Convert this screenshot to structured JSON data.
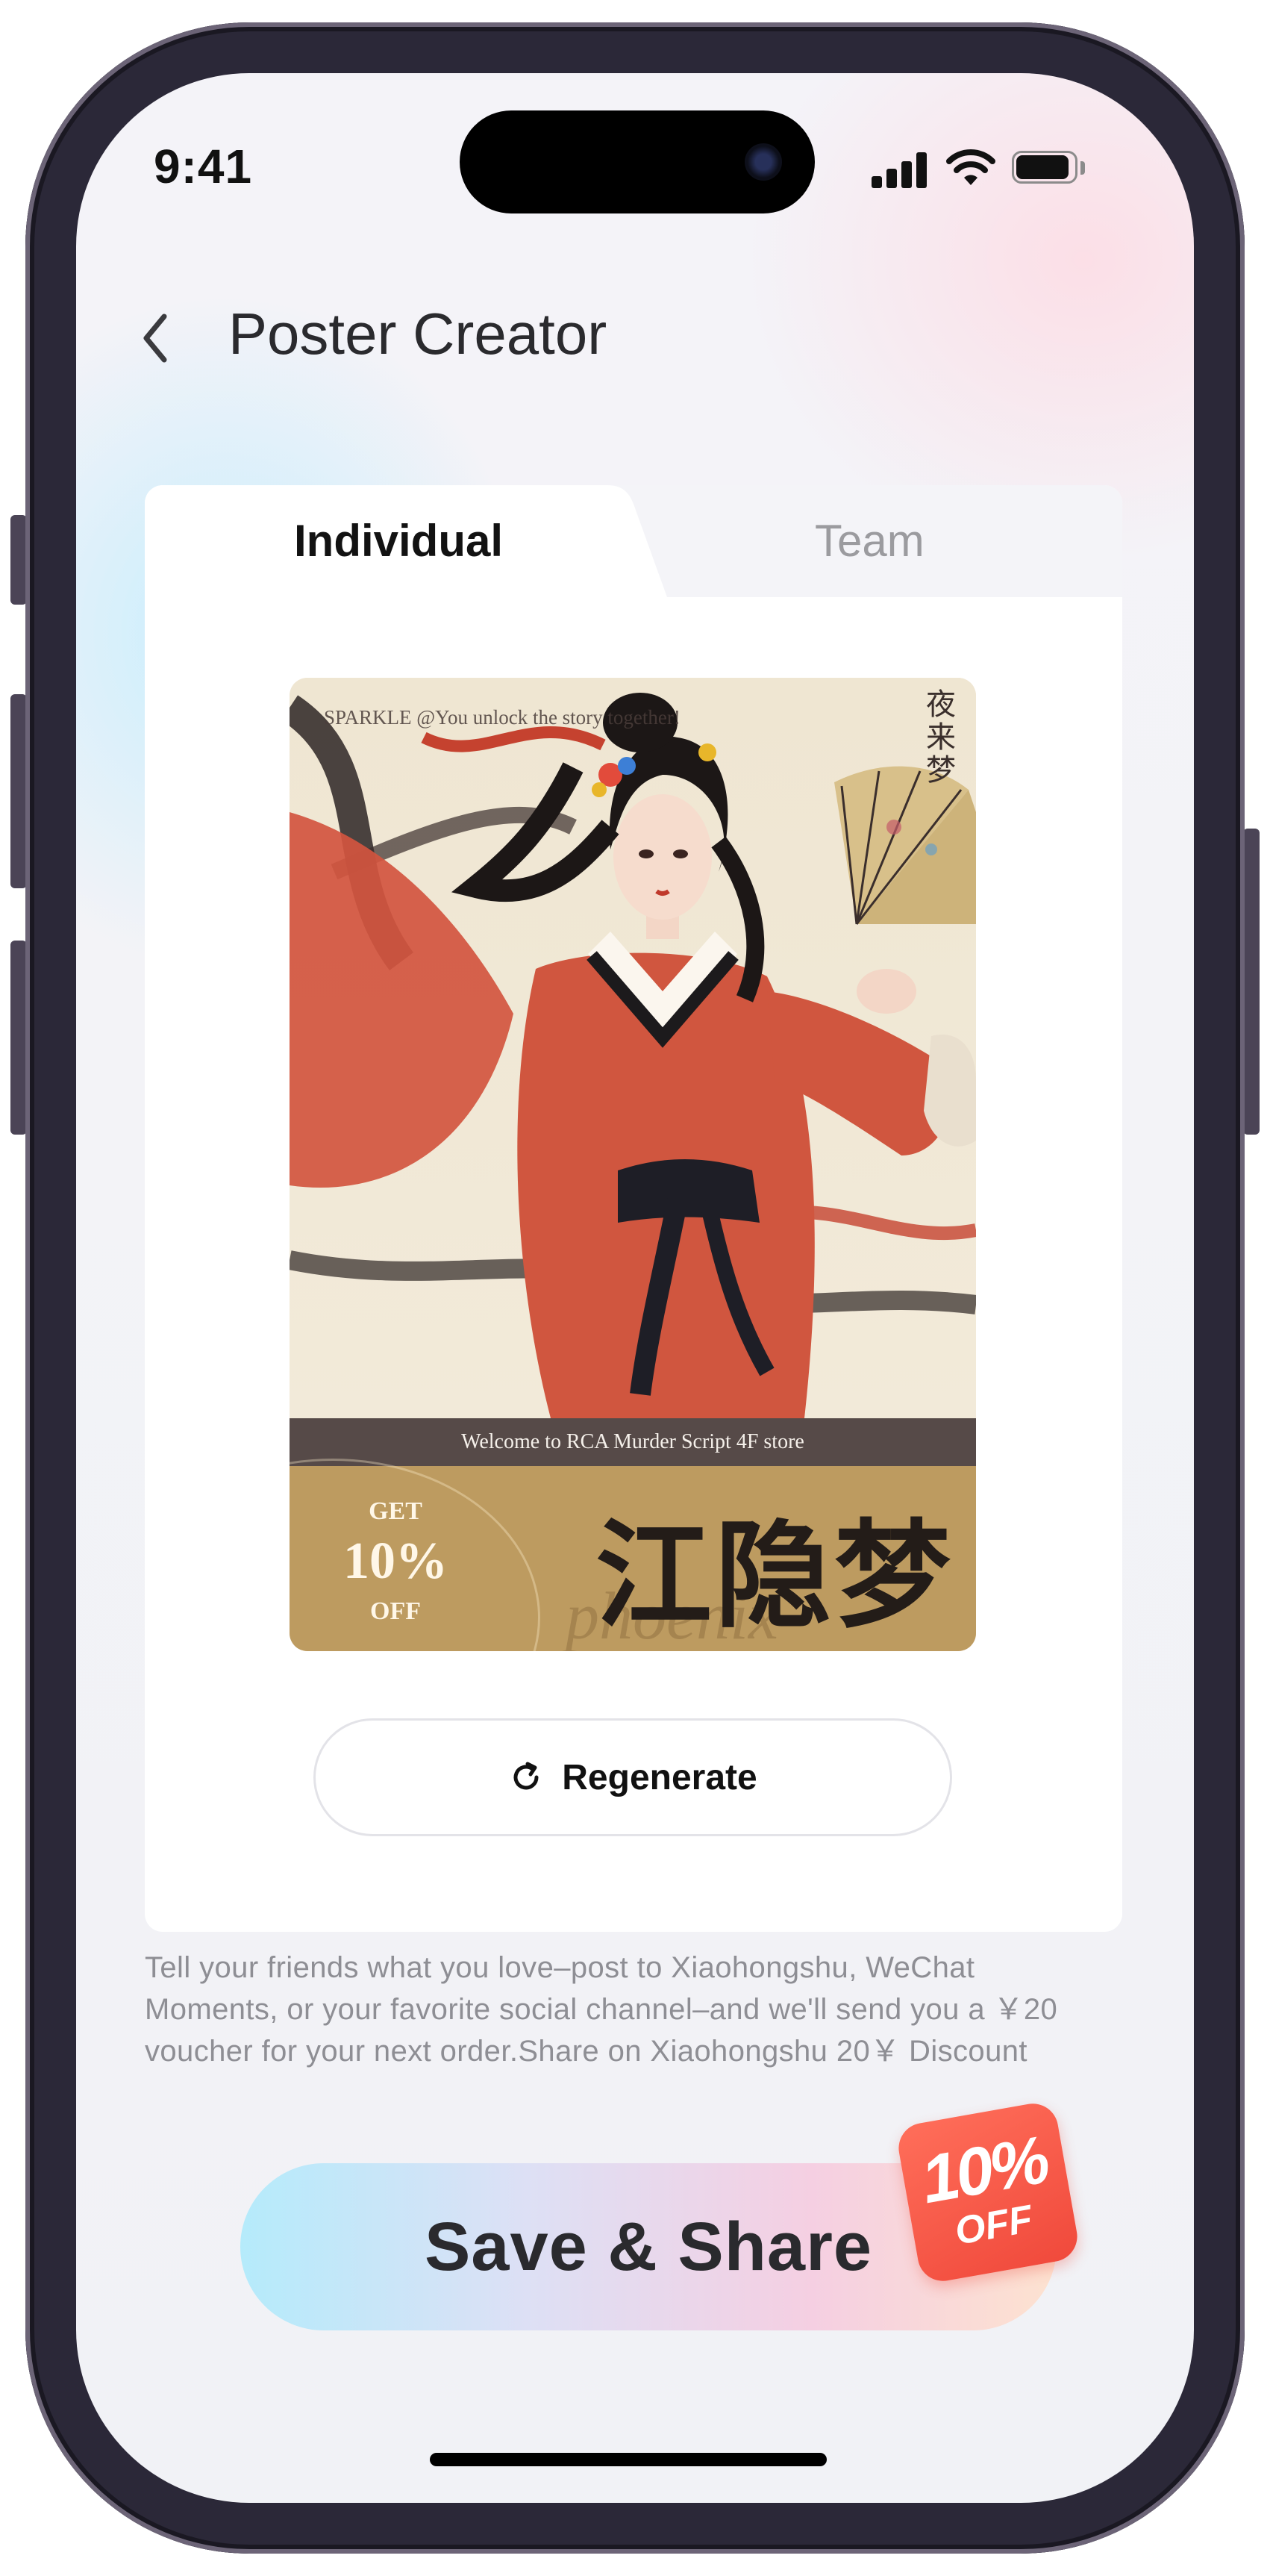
{
  "status_bar": {
    "time": "9:41"
  },
  "header": {
    "title": "Poster Creator"
  },
  "tabs": [
    {
      "label": "Individual",
      "active": true
    },
    {
      "label": "Team",
      "active": false
    }
  ],
  "poster": {
    "watermark": "SPARKLE @You unlock the story together!",
    "seal_text": "夜来梦",
    "welcome": "Welcome to RCA Murder Script 4F store",
    "promo_get": "GET",
    "promo_percent": "10%",
    "promo_off": "OFF",
    "calligraphy": "江隐梦",
    "script_text": "phoenix"
  },
  "regenerate": {
    "label": "Regenerate",
    "icon": "refresh-icon"
  },
  "description": "Tell your friends what you love–post to Xiaohongshu, WeChat Moments, or your favorite social channel–and we'll send you a ￥20 voucher for your next order.Share on Xiaohongshu 20￥ Discount",
  "save_share": {
    "label": "Save & Share"
  },
  "badge": {
    "percent": "10%",
    "off": "OFF"
  },
  "colors": {
    "accent_badge": "#f0493b",
    "poster_gold": "#bd9b60",
    "poster_bar": "#564a48",
    "text_primary": "#2a2a2e",
    "text_muted": "#8e8e94"
  }
}
